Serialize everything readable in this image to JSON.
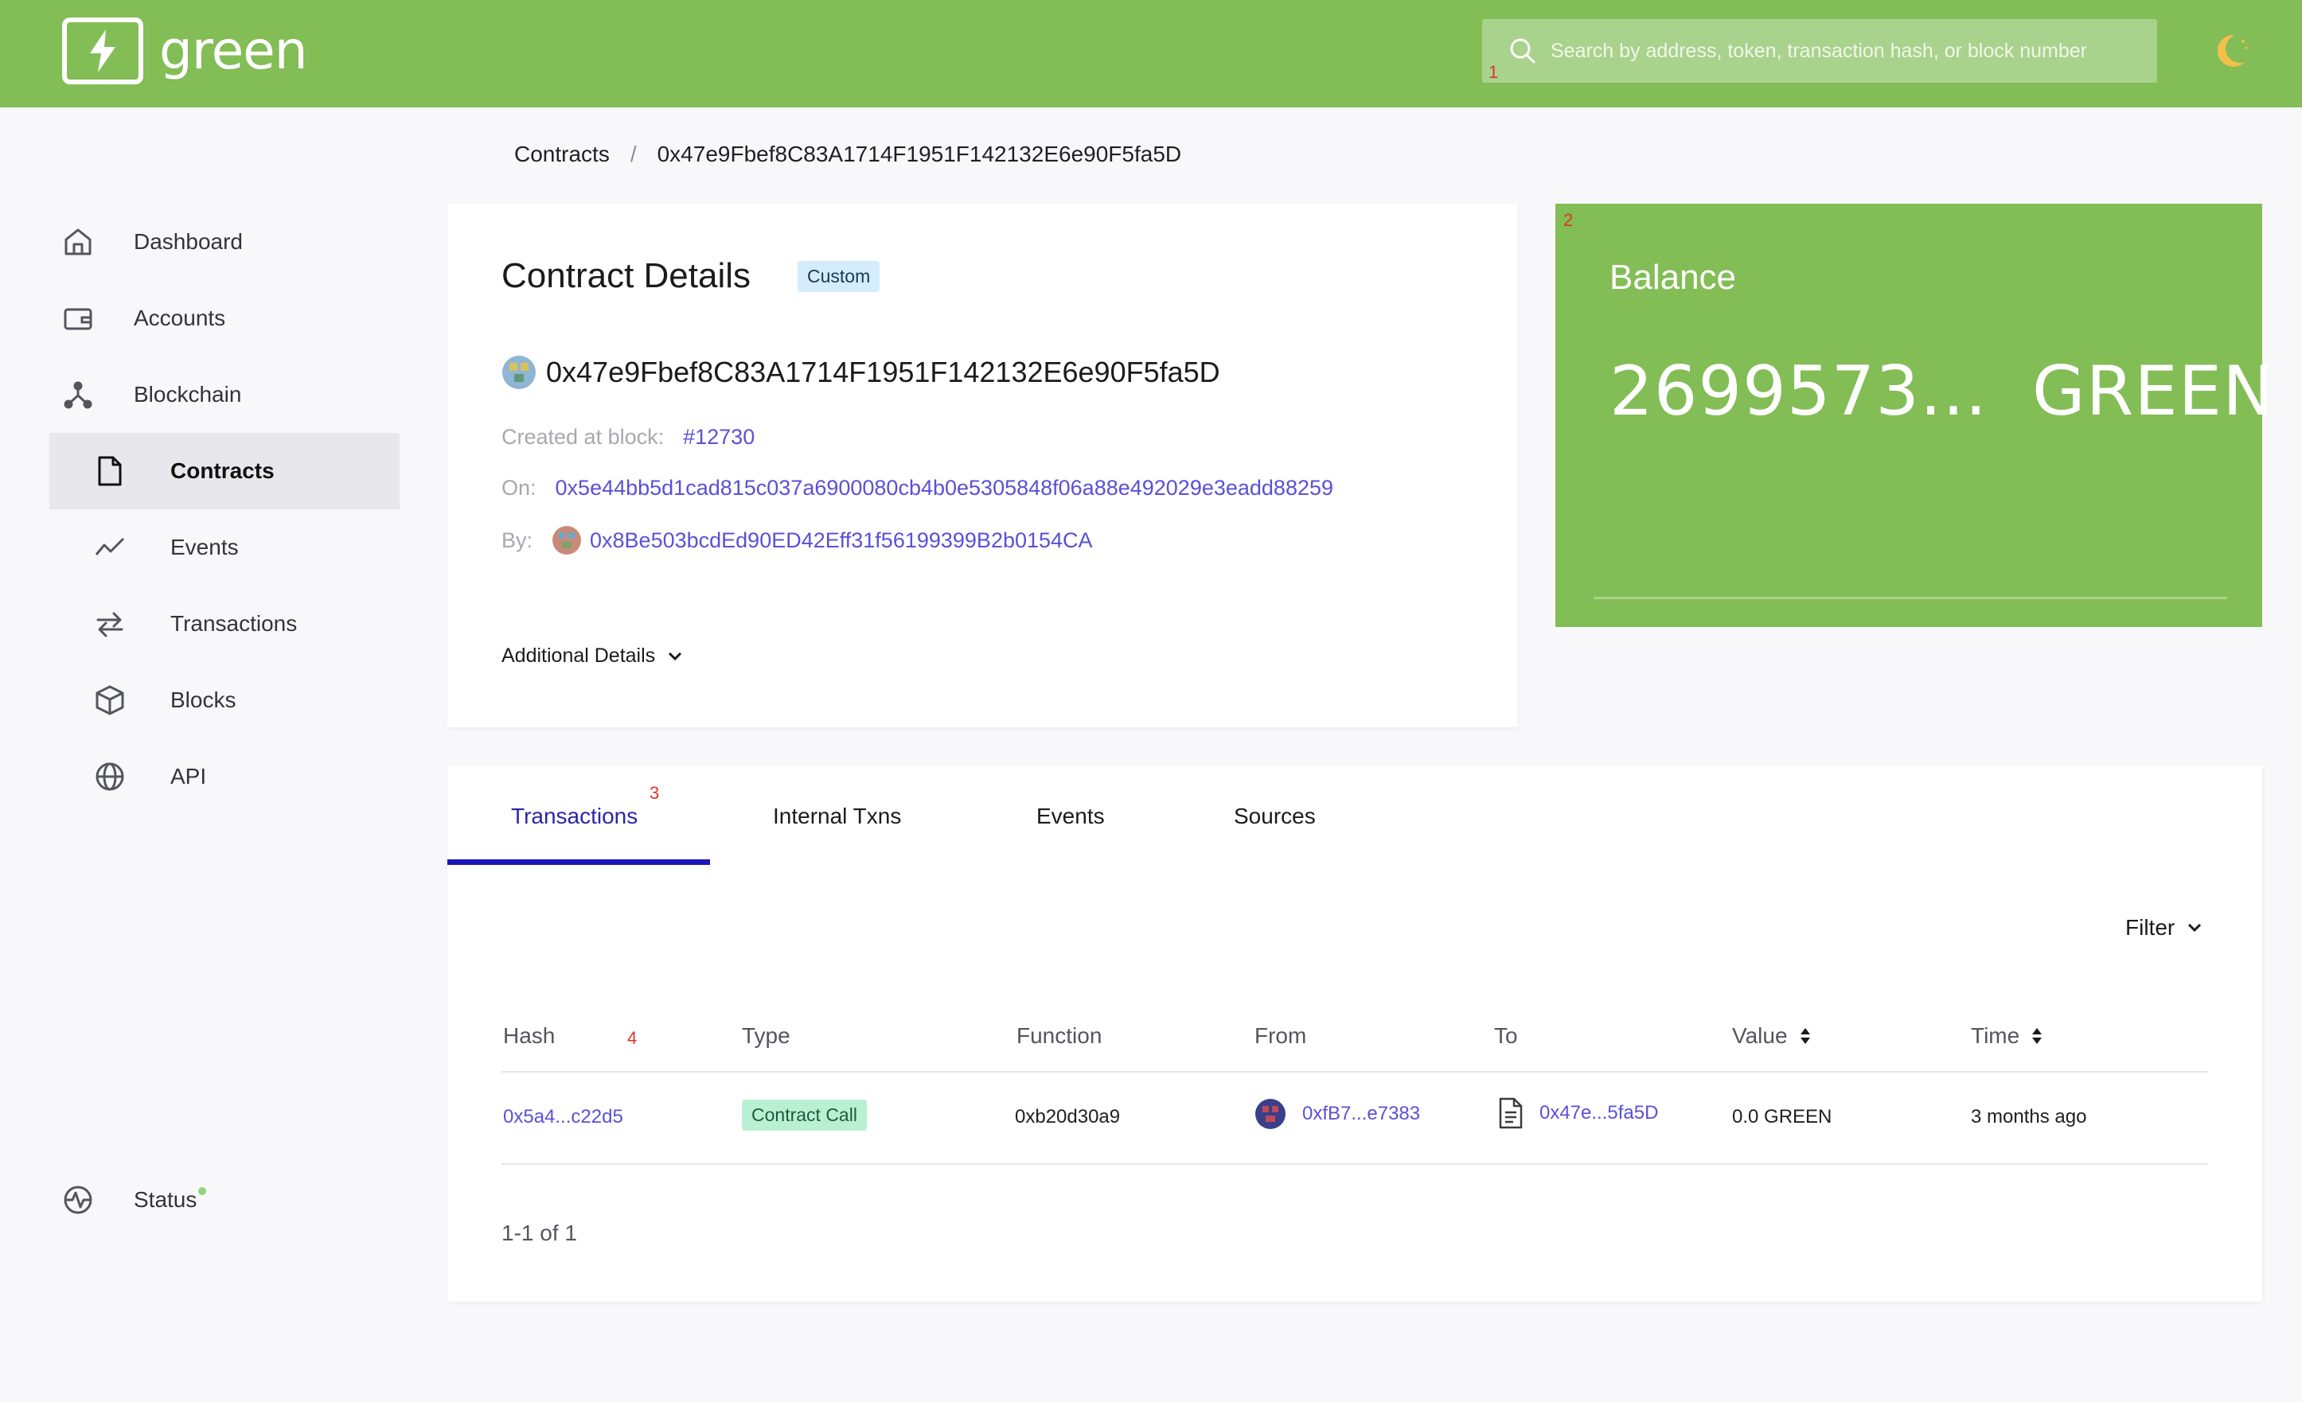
{
  "header": {
    "logo_text": "green",
    "search_placeholder": "Search by address, token, transaction hash, or block number",
    "search_marker": "1",
    "brand_color": "#83bd56"
  },
  "breadcrumb": {
    "root": "Contracts",
    "separator": "/",
    "current": "0x47e9Fbef8C83A1714F1951F142132E6e90F5fa5D"
  },
  "sidebar": {
    "items": [
      {
        "label": "Dashboard",
        "icon": "home-icon"
      },
      {
        "label": "Accounts",
        "icon": "wallet-icon"
      },
      {
        "label": "Blockchain",
        "icon": "network-icon"
      },
      {
        "label": "Contracts",
        "icon": "document-icon",
        "active": true
      },
      {
        "label": "Events",
        "icon": "activity-icon"
      },
      {
        "label": "Transactions",
        "icon": "swap-icon"
      },
      {
        "label": "Blocks",
        "icon": "cube-icon"
      },
      {
        "label": "API",
        "icon": "globe-icon"
      }
    ],
    "status_label": "Status"
  },
  "contract": {
    "title": "Contract Details",
    "badge": "Custom",
    "address": "0x47e9Fbef8C83A1714F1951F142132E6e90F5fa5D",
    "created_label": "Created at block:",
    "created_block": "#12730",
    "on_label": "On:",
    "on_hash": "0x5e44bb5d1cad815c037a6900080cb4b0e5305848f06a88e492029e3eadd88259",
    "by_label": "By:",
    "by_address": "0x8Be503bcdEd90ED42Eff31f56199399B2b0154CA",
    "additional_details": "Additional Details"
  },
  "balance": {
    "title": "Balance",
    "amount": "2699573...",
    "unit": "GREEN",
    "marker": "2"
  },
  "tabs": {
    "items": [
      "Transactions",
      "Internal Txns",
      "Events",
      "Sources"
    ],
    "marker": "3"
  },
  "table": {
    "filter_label": "Filter",
    "headers": [
      "Hash",
      "Type",
      "Function",
      "From",
      "To",
      "Value",
      "Time"
    ],
    "hash_marker": "4",
    "rows": [
      {
        "hash": "0x5a4...c22d5",
        "type": "Contract Call",
        "function": "0xb20d30a9",
        "from": "0xfB7...e7383",
        "to": "0x47e...5fa5D",
        "value": "0.0 GREEN",
        "time": "3 months ago"
      }
    ],
    "pagination": "1-1 of 1"
  }
}
